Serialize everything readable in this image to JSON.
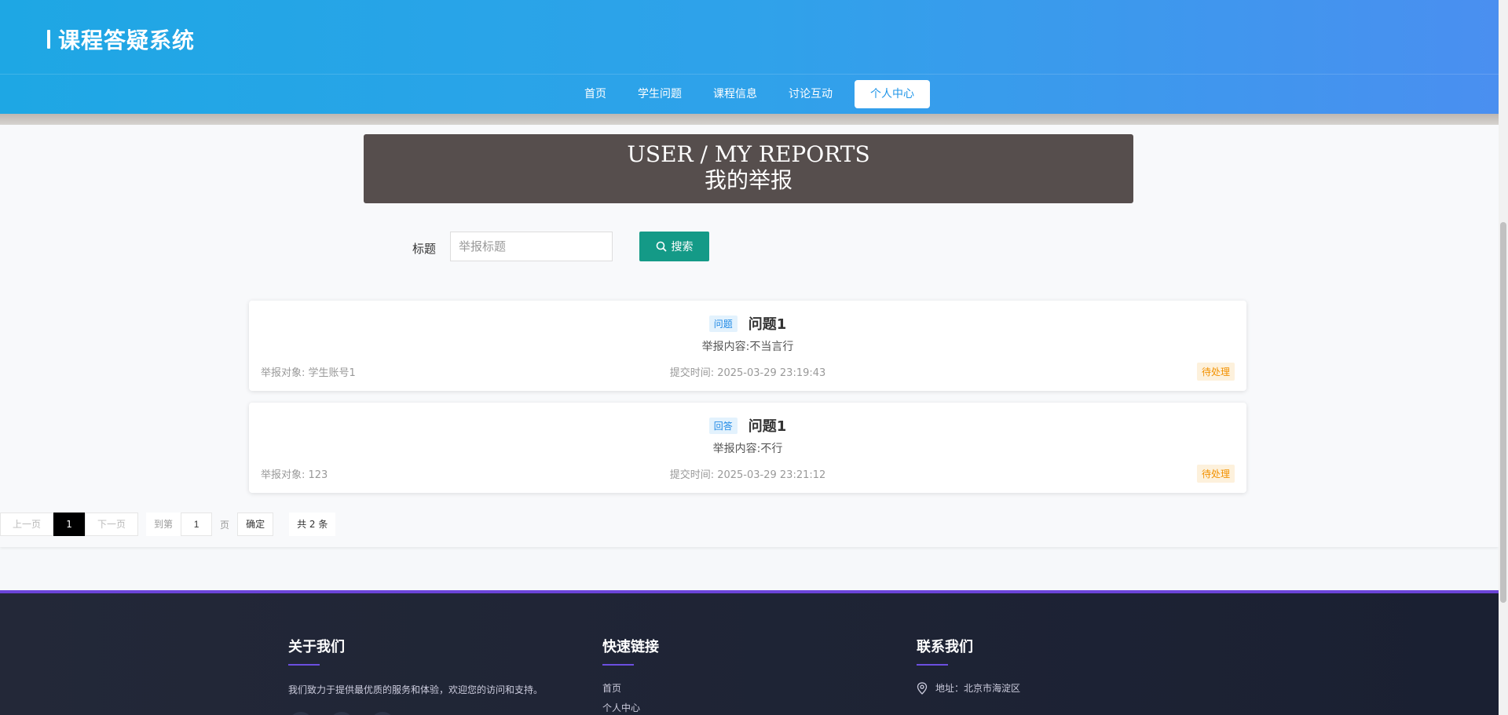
{
  "header": {
    "title": "课程答疑系统",
    "nav": [
      {
        "label": "首页"
      },
      {
        "label": "学生问题"
      },
      {
        "label": "课程信息"
      },
      {
        "label": "讨论互动"
      },
      {
        "label": "个人中心",
        "active": true
      }
    ]
  },
  "page": {
    "title_en": "USER / MY REPORTS",
    "title_cn": "我的举报"
  },
  "search": {
    "label": "标题",
    "placeholder": "举报标题",
    "button_label": "搜索",
    "button_icon": "search-icon"
  },
  "reports": [
    {
      "tag": "问题",
      "title": "问题1",
      "content": "举报内容:不当言行",
      "target": "举报对象: 学生账号1",
      "time": "提交时间: 2025-03-29 23:19:43",
      "status": "待处理"
    },
    {
      "tag": "回答",
      "title": "问题1",
      "content": "举报内容:不行",
      "target": "举报对象: 123",
      "time": "提交时间: 2025-03-29 23:21:12",
      "status": "待处理"
    }
  ],
  "pagination": {
    "prev": "上一页",
    "current": "1",
    "next": "下一页",
    "goto_label": "到第",
    "goto_value": "1",
    "page_suffix": "页",
    "confirm": "确定",
    "total": "共 2 条"
  },
  "footer": {
    "about_heading": "关于我们",
    "about_text": "我们致力于提供最优质的服务和体验，欢迎您的访问和支持。",
    "links_heading": "快速链接",
    "links": [
      "首页",
      "个人中心"
    ],
    "contact_heading": "联系我们",
    "address": "地址：北京市海淀区"
  },
  "colors": {
    "header_start": "#1ea7e4",
    "header_end": "#4a8ff0",
    "search_button": "#149a87",
    "status": "#f29100",
    "footer_accent": "#6b44d8"
  }
}
